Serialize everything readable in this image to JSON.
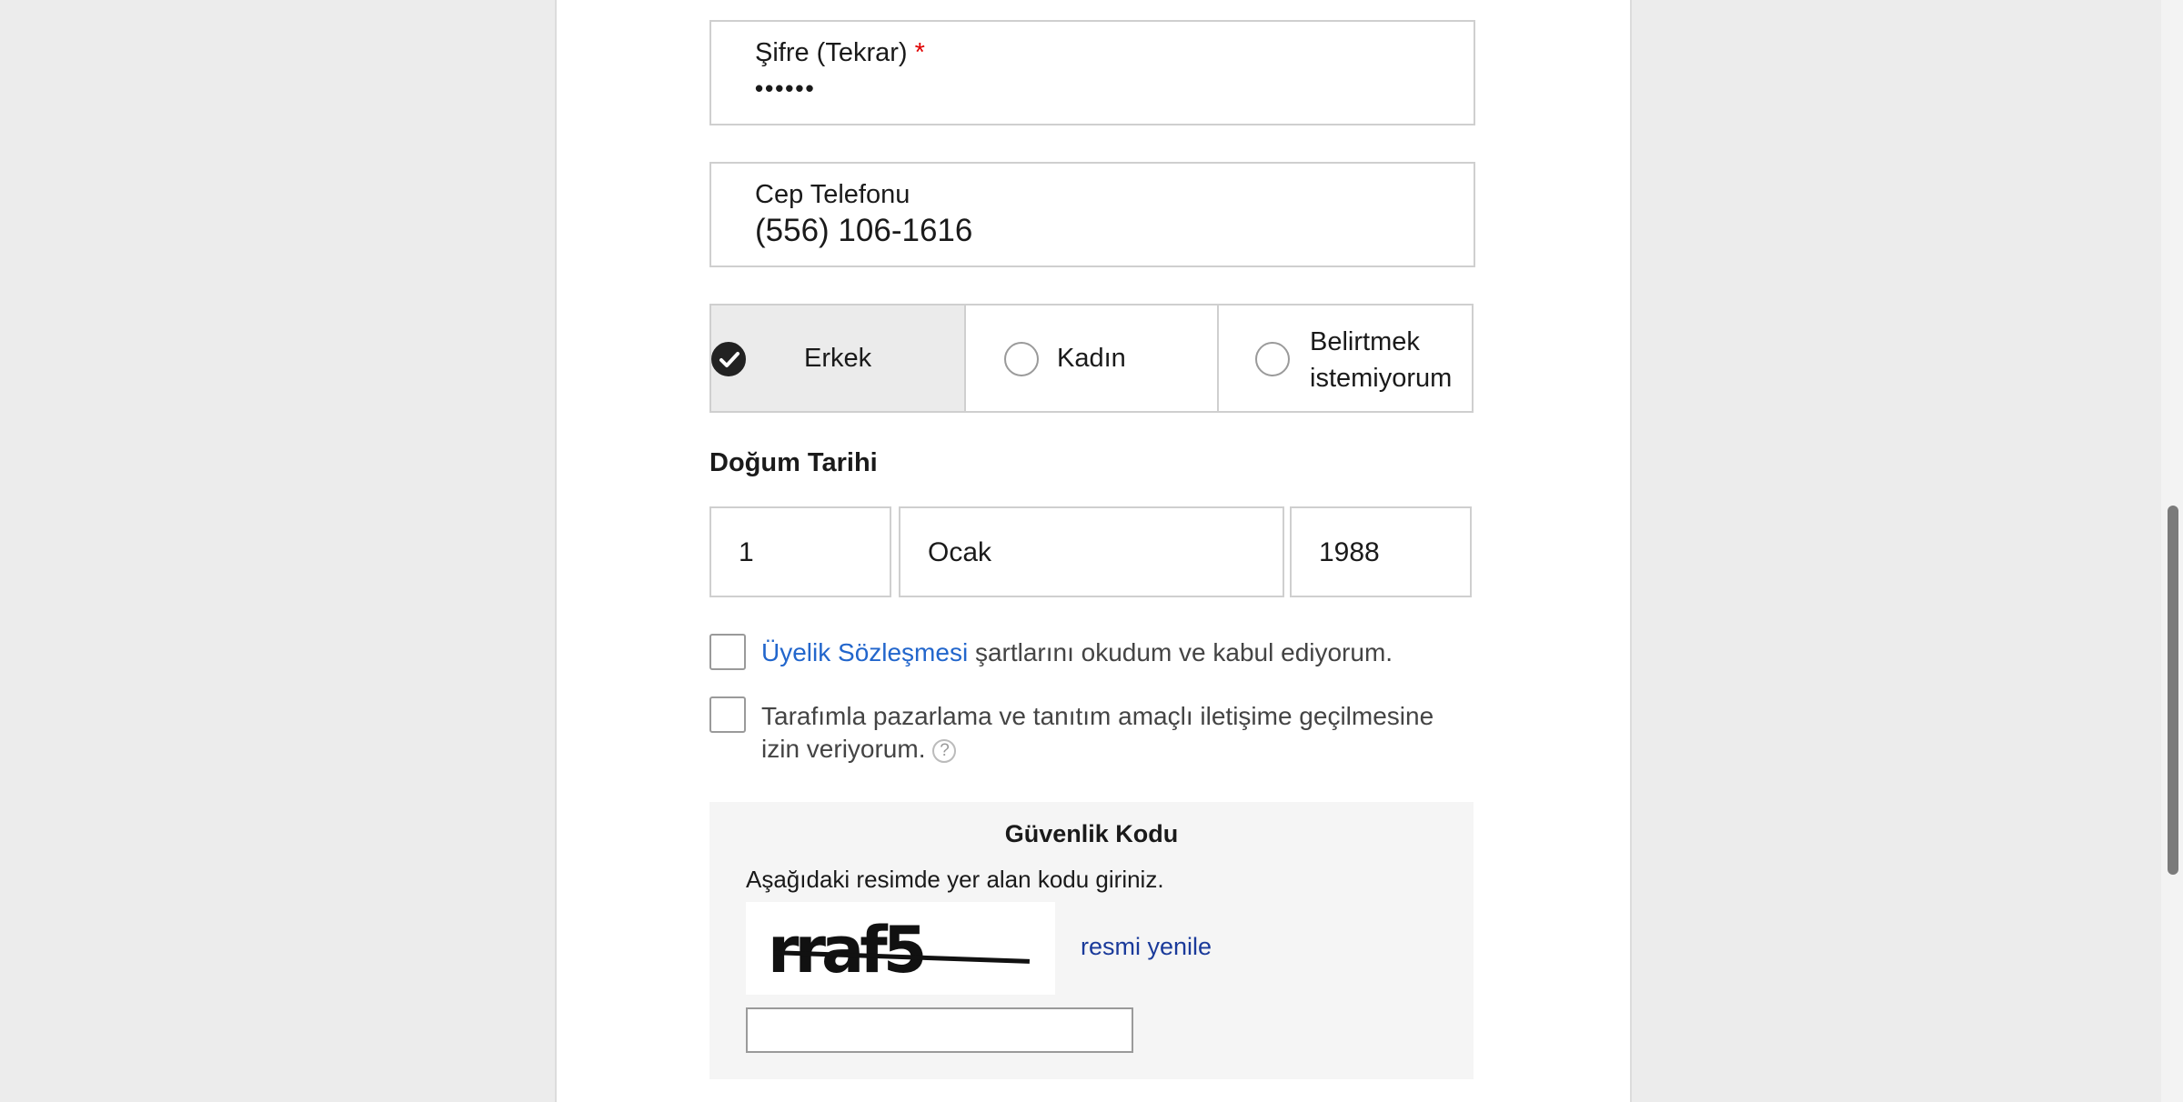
{
  "password_confirm": {
    "label": "Şifre (Tekrar)",
    "required_mark": "*",
    "value": "••••••"
  },
  "phone": {
    "label": "Cep Telefonu",
    "value": "(556) 106-1616"
  },
  "gender": {
    "options": [
      {
        "label": "Erkek",
        "selected": true
      },
      {
        "label": "Kadın",
        "selected": false
      },
      {
        "label": "Belirtmek istemiyorum",
        "selected": false
      }
    ]
  },
  "birth_date": {
    "title": "Doğum Tarihi",
    "day": "1",
    "month": "Ocak",
    "year": "1988"
  },
  "agreements": {
    "terms_link": "Üyelik Sözleşmesi",
    "terms_text": " şartlarını okudum ve kabul ediyorum.",
    "marketing_line1": "Tarafımla pazarlama ve tanıtım amaçlı iletişime geçilmesine",
    "marketing_line2": "izin veriyorum.",
    "help_symbol": "?"
  },
  "captcha": {
    "title": "Güvenlik Kodu",
    "instruction": "Aşağıdaki resimde yer alan kodu giriniz.",
    "image_text": "rraf5",
    "refresh_label": "resmi yenile",
    "input_value": ""
  }
}
